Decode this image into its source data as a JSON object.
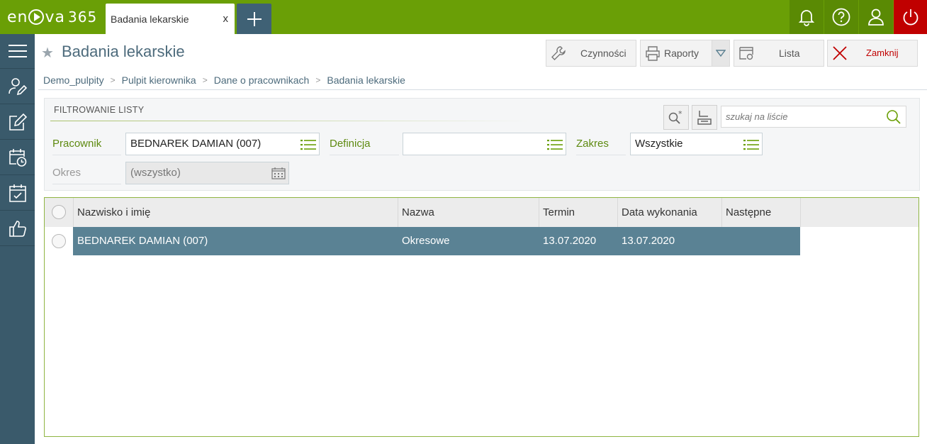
{
  "app": {
    "logo_text": "en",
    "logo_text2": "va",
    "logo_num": "365"
  },
  "tabs": [
    {
      "label": "Badania lekarskie",
      "close": "x"
    }
  ],
  "topbar": {
    "icons": [
      "bell-icon",
      "help-icon",
      "user-icon",
      "power-icon"
    ]
  },
  "sidebar": {
    "items": [
      "menu-icon",
      "user-edit-icon",
      "edit-icon",
      "calendar-clock-icon",
      "calendar-check-icon",
      "thumbs-up-icon"
    ]
  },
  "header": {
    "title": "Badania lekarskie"
  },
  "toolbar": {
    "czynnosci": "Czynności",
    "raporty": "Raporty",
    "lista": "Lista",
    "zamknij": "Zamknij"
  },
  "breadcrumb": [
    "Demo_pulpity",
    "Pulpit kierownika",
    "Dane o pracownikach",
    "Badania lekarskie"
  ],
  "filter": {
    "title": "FILTROWANIE LISTY",
    "search_placeholder": "szukaj na liście",
    "pracownik_label": "Pracownik",
    "pracownik_value": "BEDNAREK DAMIAN (007)",
    "definicja_label": "Definicja",
    "definicja_value": "",
    "zakres_label": "Zakres",
    "zakres_value": "Wszystkie",
    "okres_label": "Okres",
    "okres_value": "(wszystko)"
  },
  "grid": {
    "columns": [
      "Nazwisko i imię",
      "Nazwa",
      "Termin",
      "Data wykonania",
      "Następne"
    ],
    "rows": [
      {
        "nazwisko": "BEDNAREK DAMIAN (007)",
        "nazwa": "Okresowe",
        "termin": "13.07.2020",
        "data_wykonania": "13.07.2020",
        "nastepne": ""
      }
    ]
  },
  "colors": {
    "brand": "#6a9f06",
    "sidebar": "#3a5a6b",
    "selected_row": "#5a8294",
    "close_red": "#c00000"
  }
}
